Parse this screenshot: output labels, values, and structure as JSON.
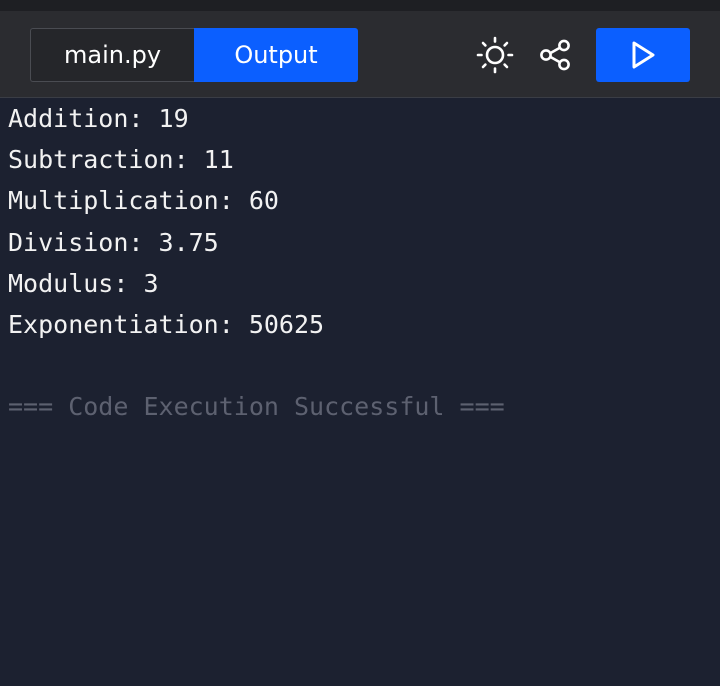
{
  "toolbar": {
    "file_tab_label": "main.py",
    "output_tab_label": "Output",
    "theme_icon": "sun-icon",
    "share_icon": "share-icon",
    "run_icon": "play-icon",
    "accent_color": "#0b5fff"
  },
  "output": {
    "lines": [
      "Addition: 19",
      "Subtraction: 11",
      "Multiplication: 60",
      "Division: 3.75",
      "Modulus: 3",
      "Exponentiation: 50625"
    ],
    "status": "=== Code Execution Successful ==="
  }
}
